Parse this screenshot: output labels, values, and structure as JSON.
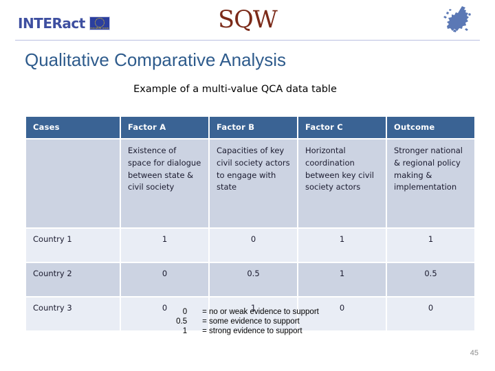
{
  "header": {
    "interact_logo_text": "INTERact",
    "eu_flag_caption": "EUROPEAN UNION",
    "sqw_logo_text": "SQW",
    "eu_map_name": "europe-map-icon"
  },
  "title": "Qualitative Comparative Analysis",
  "subtitle": "Example of a multi-value QCA data table",
  "table": {
    "headers": [
      "Cases",
      "Factor A",
      "Factor B",
      "Factor C",
      "Outcome"
    ],
    "descriptions": [
      "",
      "Existence of space for dialogue between state & civil society",
      "Capacities of key civil society actors to engage with state",
      "Horizontal coordination between key civil society actors",
      "Stronger national & regional policy making & implementation"
    ],
    "rows": [
      {
        "case": "Country 1",
        "values": [
          "1",
          "0",
          "1",
          "1"
        ]
      },
      {
        "case": "Country 2",
        "values": [
          "0",
          "0.5",
          "1",
          "0.5"
        ]
      },
      {
        "case": "Country 3",
        "values": [
          "0",
          "1",
          "0",
          "0"
        ]
      }
    ]
  },
  "legend": [
    {
      "key": "0",
      "text": "= no or weak evidence to support"
    },
    {
      "key": "0.5",
      "text": "= some evidence to support"
    },
    {
      "key": "1",
      "text": "= strong evidence to support"
    }
  ],
  "slide_number": "45",
  "colors": {
    "title_blue": "#2e5b8c",
    "header_blue": "#3a6394",
    "row_light": "#e9edf5",
    "row_dark": "#ccd3e2",
    "sqw_brown": "#7b2a19",
    "interact_blue": "#3e4fa0"
  }
}
